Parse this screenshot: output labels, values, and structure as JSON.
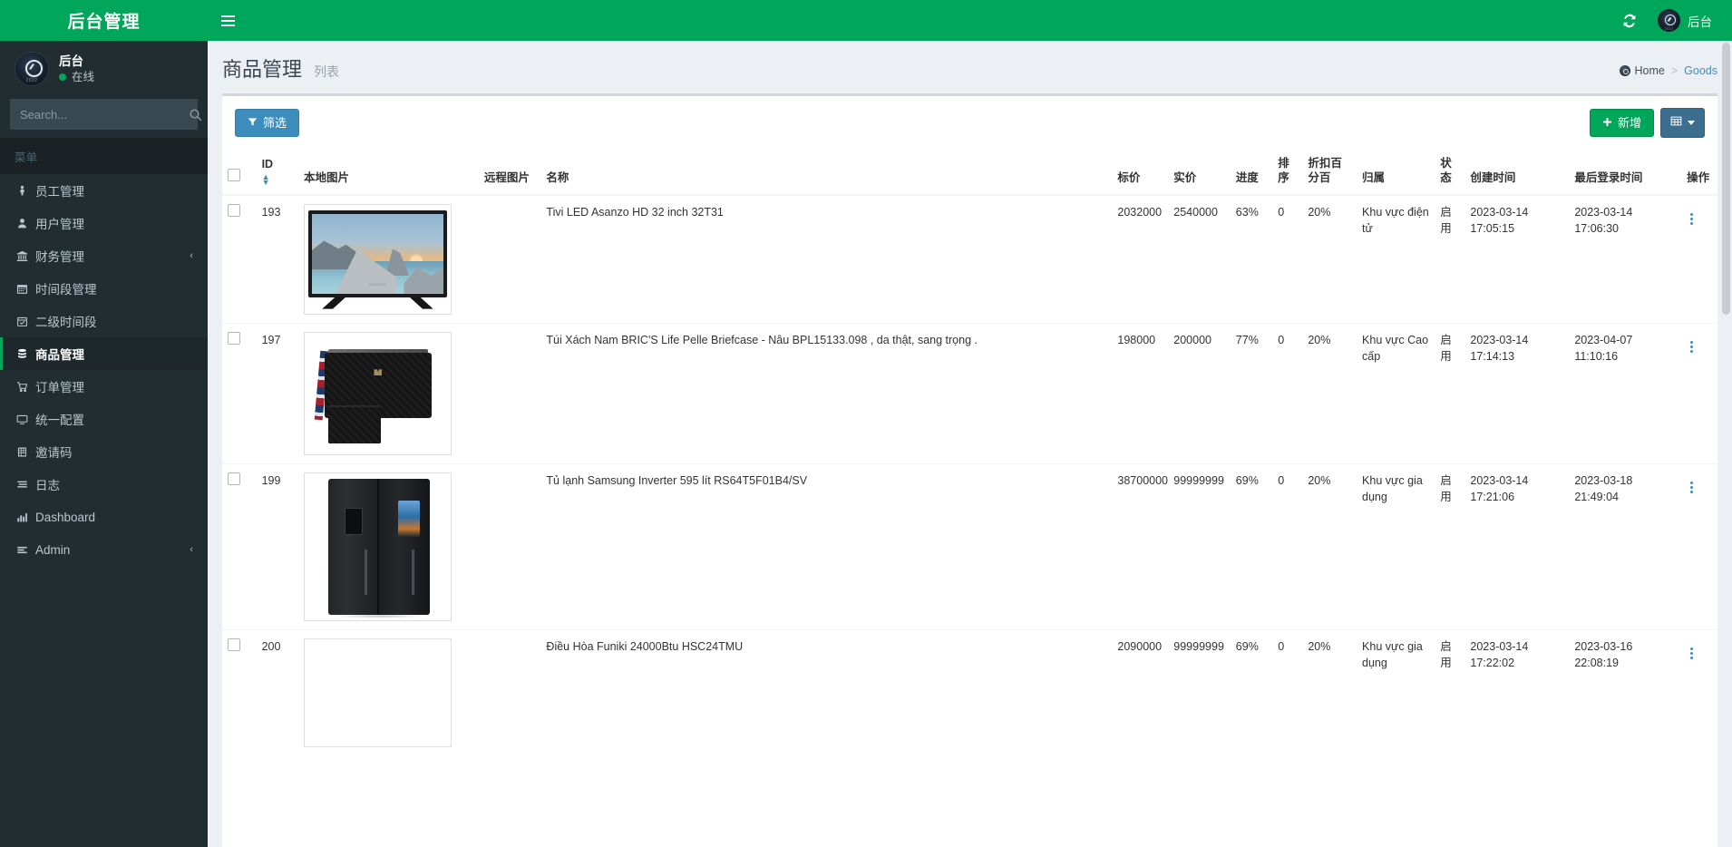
{
  "sidebar": {
    "logo": "后台管理",
    "user": {
      "name": "后台",
      "status": "在线",
      "avatar_year": "2022"
    },
    "search": {
      "placeholder": "Search...",
      "value": "",
      "icon": "search-icon"
    },
    "menu_header": "菜单",
    "items": [
      {
        "label": "员工管理",
        "icon": "employee-icon",
        "arrow": "",
        "active": false
      },
      {
        "label": "用户管理",
        "icon": "user-icon",
        "arrow": "",
        "active": false
      },
      {
        "label": "财务管理",
        "icon": "bank-icon",
        "arrow": "‹",
        "active": false
      },
      {
        "label": "时间段管理",
        "icon": "calendar-icon",
        "arrow": "",
        "active": false
      },
      {
        "label": "二级时间段",
        "icon": "calendar-check-icon",
        "arrow": "",
        "active": false
      },
      {
        "label": "商品管理",
        "icon": "database-icon",
        "arrow": "",
        "active": true
      },
      {
        "label": "订单管理",
        "icon": "cart-icon",
        "arrow": "",
        "active": false
      },
      {
        "label": "统一配置",
        "icon": "monitor-icon",
        "arrow": "",
        "active": false
      },
      {
        "label": "邀请码",
        "icon": "ticket-icon",
        "arrow": "",
        "active": false
      },
      {
        "label": "日志",
        "icon": "list-icon",
        "arrow": "",
        "active": false
      },
      {
        "label": "Dashboard",
        "icon": "chart-icon",
        "arrow": "",
        "active": false
      },
      {
        "label": "Admin",
        "icon": "bars-icon",
        "arrow": "‹",
        "active": false
      }
    ]
  },
  "topbar": {
    "menu_toggle": "hamburger-icon",
    "refresh": "refresh-icon",
    "user_label": "后台"
  },
  "header": {
    "title": "商品管理",
    "subtitle": "列表",
    "breadcrumb": {
      "home": "Home",
      "separator": ">",
      "current": "Goods"
    }
  },
  "toolbar": {
    "filter_label": "筛选",
    "filter_icon": "funnel-icon",
    "add_label": "新增",
    "add_icon": "plus-icon",
    "columns_icon": "table-icon",
    "columns_caret": "caret-down-icon"
  },
  "table": {
    "columns": [
      "ID",
      "本地图片",
      "远程图片",
      "名称",
      "标价",
      "实价",
      "进度",
      "排序",
      "折扣百分百",
      "归属",
      "状态",
      "创建时间",
      "最后登录时间",
      "操作"
    ],
    "rows": [
      {
        "id": "193",
        "name": "Tivi LED Asanzo HD 32 inch 32T31",
        "list_price": "2032000",
        "real_price": "2540000",
        "progress": "63%",
        "sort": "0",
        "discount": "20%",
        "owner": "Khu vực điện tử",
        "status": "启用",
        "created_at": "2023-03-14 17:05:15",
        "last_login": "2023-03-14 17:06:30",
        "image": "tv"
      },
      {
        "id": "197",
        "name": "Túi Xách Nam BRIC'S Life Pelle Briefcase - Nâu BPL15133.098 , da thật, sang trọng .",
        "list_price": "198000",
        "real_price": "200000",
        "progress": "77%",
        "sort": "0",
        "discount": "20%",
        "owner": "Khu vực Cao cấp",
        "status": "启用",
        "created_at": "2023-03-14 17:14:13",
        "last_login": "2023-04-07 11:10:16",
        "image": "bag"
      },
      {
        "id": "199",
        "name": "Tủ lạnh Samsung Inverter 595 lít RS64T5F01B4/SV",
        "list_price": "38700000",
        "real_price": "99999999",
        "progress": "69%",
        "sort": "0",
        "discount": "20%",
        "owner": "Khu vực gia dụng",
        "status": "启用",
        "created_at": "2023-03-14 17:21:06",
        "last_login": "2023-03-18 21:49:04",
        "image": "fridge"
      },
      {
        "id": "200",
        "name": "Điều Hòa Funiki 24000Btu HSC24TMU",
        "list_price": "2090000",
        "real_price": "99999999",
        "progress": "69%",
        "sort": "0",
        "discount": "20%",
        "owner": "Khu vực gia dụng",
        "status": "启用",
        "created_at": "2023-03-14 17:22:02",
        "last_login": "2023-03-16 22:08:19",
        "image": "empty"
      }
    ],
    "row_action_icon": "vertical-ellipsis-icon"
  },
  "colors": {
    "brand_green": "#00a65a",
    "sidebar_dark": "#222d32",
    "accent_blue": "#3c8dbc",
    "page_bg": "#ecf0f5"
  }
}
